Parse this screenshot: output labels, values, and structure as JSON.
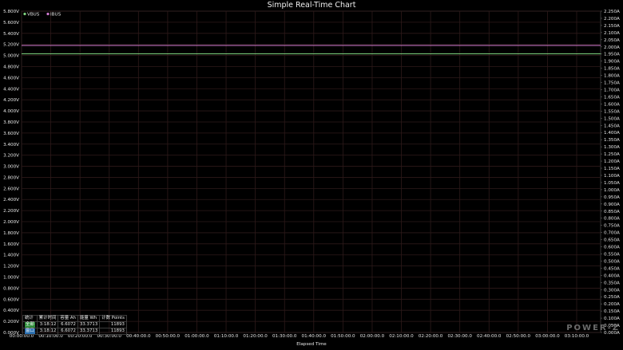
{
  "chart_data": {
    "type": "line",
    "title": "Simple Real-Time Chart",
    "xlabel": "Elapsed Time",
    "x_ticks": [
      "00:00:00.0",
      "00:10:00.0",
      "00:20:00.0",
      "00:30:00.0",
      "00:40:00.0",
      "00:50:00.0",
      "01:00:00.0",
      "01:10:00.0",
      "01:20:00.0",
      "01:30:00.0",
      "01:40:00.0",
      "01:50:00.0",
      "02:00:00.0",
      "02:10:00.0",
      "02:20:00.0",
      "02:30:00.0",
      "02:40:00.0",
      "02:50:00.0",
      "03:00:00.0",
      "03:10:00.0"
    ],
    "xlim_minutes": [
      0,
      198.2
    ],
    "y_left": {
      "ylim": [
        0,
        5.8
      ],
      "ticks": [
        "0.000V",
        "0.200V",
        "0.400V",
        "0.600V",
        "0.800V",
        "1.000V",
        "1.200V",
        "1.400V",
        "1.600V",
        "1.800V",
        "2.000V",
        "2.200V",
        "2.400V",
        "2.600V",
        "2.800V",
        "3.000V",
        "3.200V",
        "3.400V",
        "3.600V",
        "3.800V",
        "4.000V",
        "4.200V",
        "4.400V",
        "4.600V",
        "4.800V",
        "5.000V",
        "5.200V",
        "5.400V",
        "5.600V",
        "5.800V"
      ]
    },
    "y_right": {
      "ylim": [
        0,
        2.25
      ],
      "ticks": [
        "0.000A",
        "0.050A",
        "0.100A",
        "0.150A",
        "0.200A",
        "0.250A",
        "0.300A",
        "0.350A",
        "0.400A",
        "0.450A",
        "0.500A",
        "0.550A",
        "0.600A",
        "0.650A",
        "0.700A",
        "0.750A",
        "0.800A",
        "0.850A",
        "0.900A",
        "0.950A",
        "1.000A",
        "1.050A",
        "1.100A",
        "1.150A",
        "1.200A",
        "1.250A",
        "1.300A",
        "1.350A",
        "1.400A",
        "1.450A",
        "1.500A",
        "1.550A",
        "1.600A",
        "1.650A",
        "1.700A",
        "1.750A",
        "1.800A",
        "1.850A",
        "1.900A",
        "1.950A",
        "2.000A",
        "2.050A",
        "2.100A",
        "2.150A",
        "2.200A",
        "2.250A"
      ]
    },
    "series": [
      {
        "name": "VBUS",
        "color": "#7fd37f",
        "axis": "left",
        "x_minutes": [
          0,
          198.2
        ],
        "values": [
          5.03,
          5.03
        ]
      },
      {
        "name": "IBUS",
        "color": "#d27bd2",
        "axis": "right",
        "x_minutes": [
          0,
          198.2
        ],
        "values": [
          2.01,
          2.01
        ]
      }
    ],
    "legend": "top-left",
    "grid": true
  },
  "stats": {
    "headers": [
      "统计",
      "累计时间",
      "容量 Ah",
      "能量 Wh",
      "计数 Points"
    ],
    "rows": [
      {
        "tag": "全部",
        "tag_color": "#2e8b3a",
        "time": "3:18:12",
        "ah": "6.6072",
        "wh": "33.3713",
        "points": "11893"
      },
      {
        "tag": "窗口",
        "tag_color": "#2a6fb0",
        "time": "3:18:12",
        "ah": "6.6072",
        "wh": "33.3713",
        "points": "11893"
      }
    ]
  },
  "brand": "POWER-Z"
}
